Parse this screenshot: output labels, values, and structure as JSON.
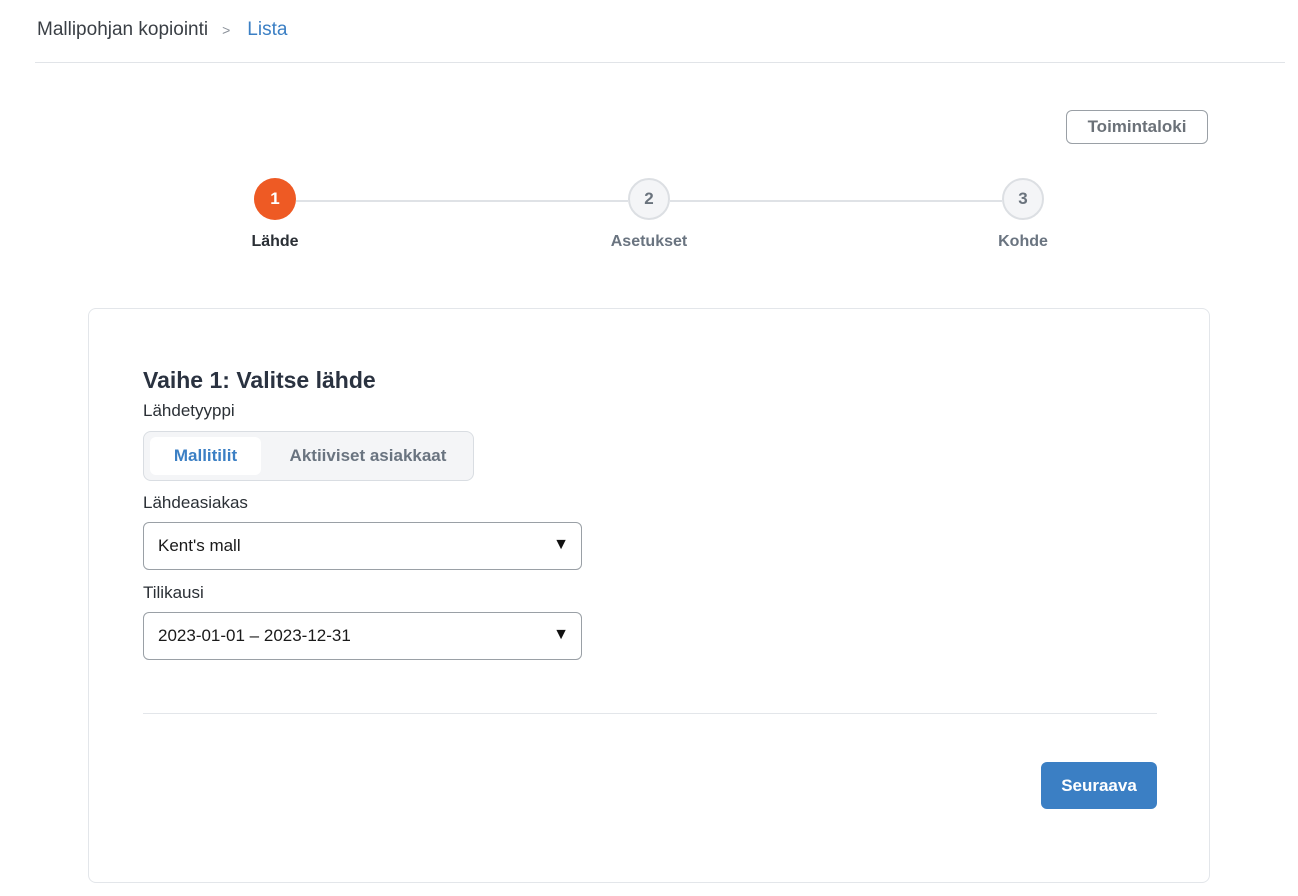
{
  "breadcrumb": {
    "root": "Mallipohjan kopiointi",
    "separator": ">",
    "current": "Lista"
  },
  "toolbar": {
    "log_label": "Toimintaloki"
  },
  "stepper": {
    "steps": [
      {
        "number": "1",
        "label": "Lähde",
        "state": "active"
      },
      {
        "number": "2",
        "label": "Asetukset",
        "state": "inactive"
      },
      {
        "number": "3",
        "label": "Kohde",
        "state": "inactive"
      }
    ]
  },
  "form": {
    "title": "Vaihe 1: Valitse lähde",
    "source_type": {
      "label": "Lähdetyyppi",
      "options": [
        "Mallitilit",
        "Aktiiviset asiakkaat"
      ],
      "selected": "Mallitilit"
    },
    "source_client": {
      "label": "Lähdeasiakas",
      "value": "Kent's mall"
    },
    "fiscal_year": {
      "label": "Tilikausi",
      "value": "2023-01-01 – 2023-12-31"
    },
    "caret": "▼",
    "next_label": "Seuraava"
  },
  "colors": {
    "accent": "#3b7fc4",
    "active_step": "#ee5a24"
  }
}
